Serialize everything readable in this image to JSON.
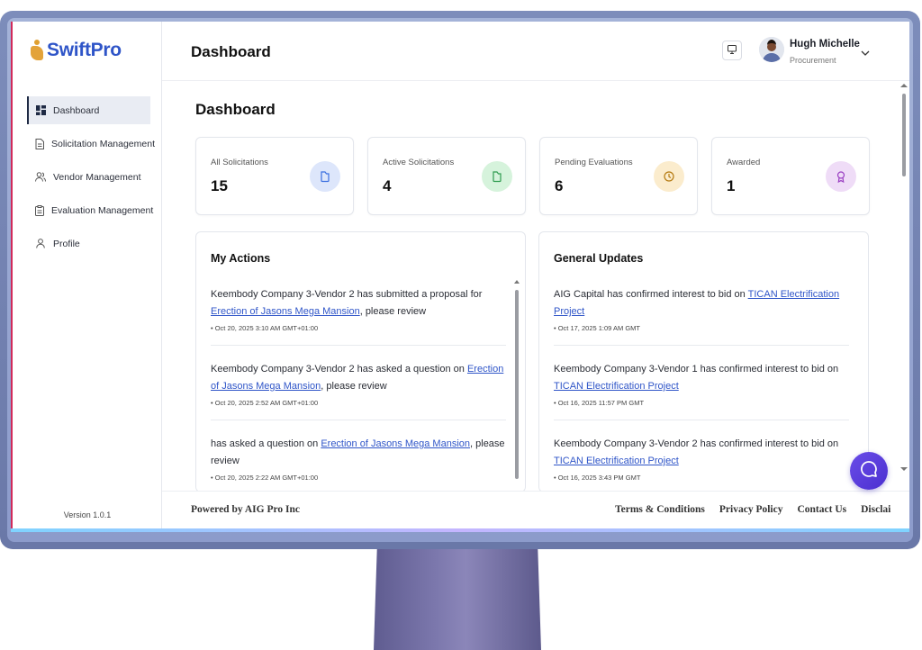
{
  "app": {
    "brand": "SwiftPro",
    "version": "Version 1.0.1"
  },
  "sidebar": {
    "items": [
      {
        "label": "Dashboard",
        "icon": "dashboard-icon",
        "active": true
      },
      {
        "label": "Solicitation Management",
        "icon": "document-icon"
      },
      {
        "label": "Vendor Management",
        "icon": "users-icon"
      },
      {
        "label": "Evaluation Management",
        "icon": "clipboard-icon"
      },
      {
        "label": "Profile",
        "icon": "user-icon"
      }
    ]
  },
  "header": {
    "title": "Dashboard",
    "user_name": "Hugh Michelle",
    "user_role": "Procurement"
  },
  "main": {
    "title": "Dashboard",
    "stats": [
      {
        "label": "All Solicitations",
        "value": "15",
        "icon": "folder-icon",
        "color": "#dde6fb",
        "icon_color": "#3b6fe0"
      },
      {
        "label": "Active Solicitations",
        "value": "4",
        "icon": "folder-icon",
        "color": "#d6f3dc",
        "icon_color": "#2f9c4f"
      },
      {
        "label": "Pending Evaluations",
        "value": "6",
        "icon": "clock-icon",
        "color": "#fbeccd",
        "icon_color": "#b57a10"
      },
      {
        "label": "Awarded",
        "value": "1",
        "icon": "award-icon",
        "color": "#efdcf7",
        "icon_color": "#9a3fc2"
      }
    ],
    "my_actions": {
      "title": "My Actions",
      "entries": [
        {
          "pre": "Keembody Company 3-Vendor 2 has submitted a proposal for ",
          "link": "Erection of Jasons Mega Mansion",
          "post": ", please review",
          "time": "• Oct 20, 2025 3:10 AM GMT+01:00"
        },
        {
          "pre": "Keembody Company 3-Vendor 2 has asked a question on ",
          "link": "Erection of Jasons Mega Mansion",
          "post": ", please review",
          "time": "• Oct 20, 2025 2:52 AM GMT+01:00"
        },
        {
          "pre": "has asked a question on ",
          "link": "Erection of Jasons Mega Mansion",
          "post": ", please review",
          "time": "• Oct 20, 2025 2:22 AM GMT+01:00"
        }
      ]
    },
    "general_updates": {
      "title": "General Updates",
      "entries": [
        {
          "pre": "AIG Capital has confirmed interest to bid on ",
          "link": "TICAN Electrification Project",
          "post": "",
          "time": "• Oct 17, 2025 1:09 AM GMT"
        },
        {
          "pre": "Keembody Company 3-Vendor 1 has confirmed interest to bid on ",
          "link": "TICAN Electrification Project",
          "post": "",
          "time": "• Oct 16, 2025 11:57 PM GMT"
        },
        {
          "pre": "Keembody Company 3-Vendor 2 has confirmed interest to bid on ",
          "link": "TICAN Electrification Project",
          "post": "",
          "time": "• Oct 16, 2025 3:43 PM GMT"
        }
      ]
    }
  },
  "footer": {
    "powered": "Powered by AIG Pro Inc",
    "links": [
      "Terms & Conditions",
      "Privacy Policy",
      "Contact Us",
      "Disclai"
    ]
  }
}
